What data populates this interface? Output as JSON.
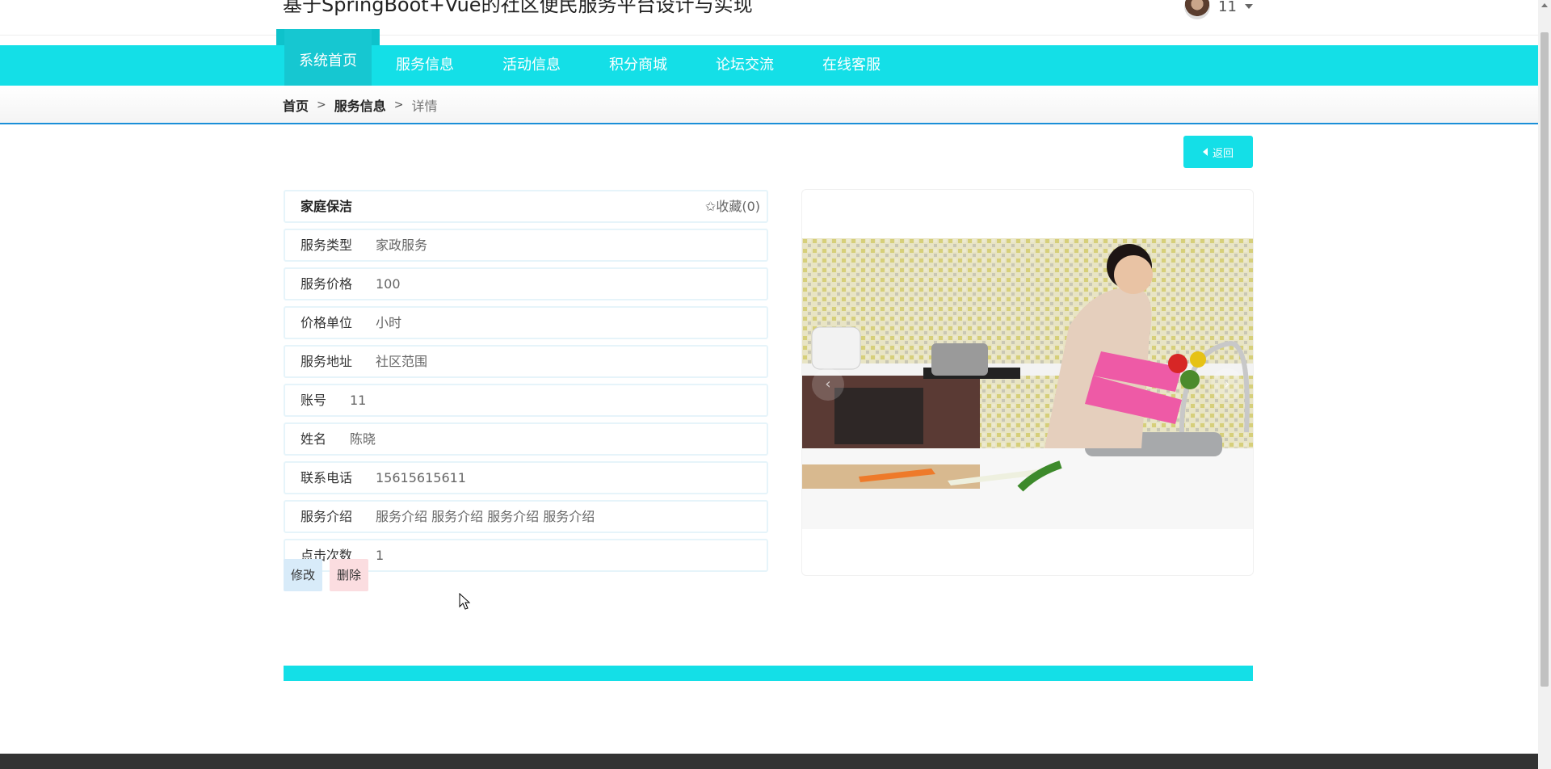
{
  "header": {
    "site_title": "基于SpringBoot+Vue的社区便民服务平台设计与实现",
    "user_name": "11"
  },
  "nav": {
    "items": [
      {
        "label": "系统首页",
        "active": true
      },
      {
        "label": "服务信息"
      },
      {
        "label": "活动信息"
      },
      {
        "label": "积分商城"
      },
      {
        "label": "论坛交流"
      },
      {
        "label": "在线客服"
      }
    ]
  },
  "breadcrumb": {
    "home": "首页",
    "sep1": ">",
    "section": "服务信息",
    "sep2": ">",
    "current": "详情"
  },
  "back_button": "返回",
  "detail": {
    "title": "家庭保洁",
    "favorite": "✩收藏(0)",
    "fields": [
      {
        "label": "服务类型",
        "value": "家政服务"
      },
      {
        "label": "服务价格",
        "value": "100"
      },
      {
        "label": "价格单位",
        "value": "小时"
      },
      {
        "label": "服务地址",
        "value": "社区范围"
      },
      {
        "label": "账号",
        "value": "11"
      },
      {
        "label": "姓名",
        "value": "陈晓"
      },
      {
        "label": "联系电话",
        "value": "15615615611"
      },
      {
        "label": "服务介绍",
        "value": "服务介绍 服务介绍 服务介绍 服务介绍"
      },
      {
        "label": "点击次数",
        "value": "1"
      }
    ]
  },
  "actions": {
    "edit": "修改",
    "delete": "删除"
  },
  "carousel": {
    "prev": "‹",
    "next": "›"
  },
  "colors": {
    "accent": "#14dfe7",
    "breadcrumb_border": "#1a8fd8",
    "footer": "#333333"
  }
}
